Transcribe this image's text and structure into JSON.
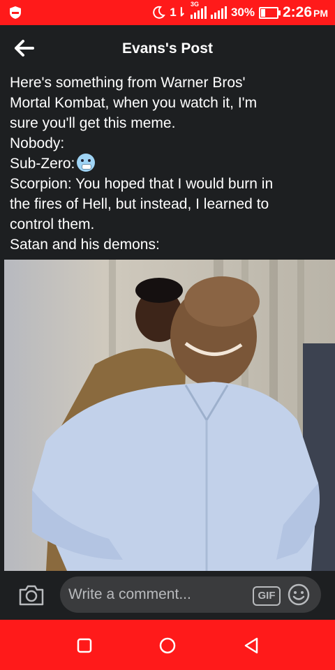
{
  "status_bar": {
    "network_label": "3G",
    "battery_percent": "30%",
    "time": "2:26",
    "ampm": "PM",
    "color": "#ff1a1a"
  },
  "header": {
    "title": "Evans's Post",
    "back_icon": "arrow-left-icon"
  },
  "post": {
    "lines": [
      "Here's something from Warner Bros'",
      "Mortal Kombat, when you watch it, I'm",
      "sure you'll get this meme.",
      "Nobody:",
      "Sub-Zero:",
      "Scorpion: You hoped that I would burn in",
      "the fires of Hell, but instead, I learned to",
      "control them.",
      "Satan and his demons:"
    ],
    "sub_zero_emoji": "cold-face-emoji"
  },
  "comment_bar": {
    "placeholder": "Write a comment...",
    "gif_label": "GIF",
    "camera_icon": "camera-icon",
    "emoji_icon": "smiley-icon"
  },
  "nav_bar": {
    "icons": [
      "recent-apps-icon",
      "home-icon",
      "back-triangle-icon"
    ]
  }
}
